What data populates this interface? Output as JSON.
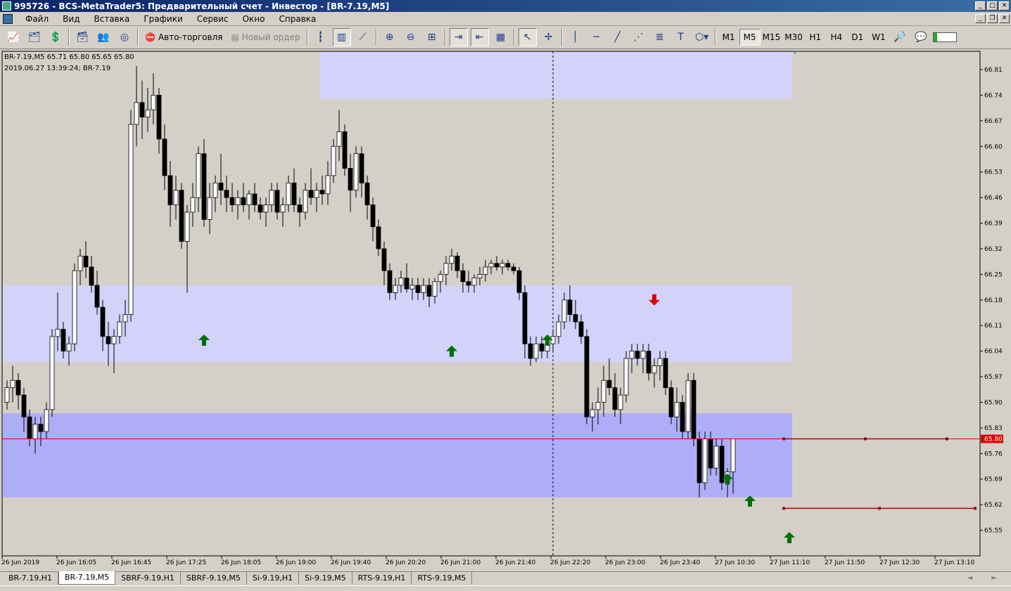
{
  "window": {
    "title": "995726 - BCS-MetaTrader5: Предварительный счет - Инвестор - [BR-7.19,M5]",
    "btn_min": "_",
    "btn_max": "□",
    "btn_close": "✕",
    "btn_restore": "❐"
  },
  "menu": {
    "items": [
      "Файл",
      "Вид",
      "Вставка",
      "Графики",
      "Сервис",
      "Окно",
      "Справка"
    ]
  },
  "toolbar": {
    "autotrade": "Авто-торговля",
    "new_order": "Новый ордер",
    "timeframes": [
      "M1",
      "M5",
      "M15",
      "M30",
      "H1",
      "H4",
      "D1",
      "W1"
    ],
    "active_timeframe": "M5"
  },
  "chart": {
    "info_symbol": "BR-7.19,M5  65.71 65.80 65.65 65.80",
    "info_time": "2019.06.27 13:39:24; BR-7.19",
    "current_price_label": "65.80",
    "colors": {
      "bg": "#d4d0c8",
      "zone_light": "#d2d2fa",
      "zone_mid": "#aeaef8",
      "price_line": "#e00000",
      "arrow_up": "#007000",
      "arrow_down": "#e00000"
    }
  },
  "chart_data": {
    "type": "candlestick",
    "symbol": "BR-7.19",
    "timeframe": "M5",
    "ylim": [
      65.48,
      66.86
    ],
    "yticks": [
      65.55,
      65.62,
      65.69,
      65.76,
      65.83,
      65.9,
      65.97,
      66.04,
      66.11,
      66.18,
      66.25,
      66.32,
      66.39,
      66.46,
      66.53,
      66.6,
      66.67,
      66.74,
      66.81
    ],
    "xlabels": [
      "26 Jun 2019",
      "26 Jun 16:05",
      "26 Jun 16:45",
      "26 Jun 17:25",
      "26 Jun 18:05",
      "26 Jun 19:00",
      "26 Jun 19:40",
      "26 Jun 20:20",
      "26 Jun 21:00",
      "26 Jun 21:40",
      "26 Jun 22:20",
      "26 Jun 23:00",
      "26 Jun 23:40",
      "27 Jun 10:30",
      "27 Jun 11:10",
      "27 Jun 11:50",
      "27 Jun 12:30",
      "27 Jun 13:10"
    ],
    "current_price": 65.8,
    "ohlc": [
      [
        65.9,
        65.96,
        65.88,
        65.94
      ],
      [
        65.94,
        66,
        65.9,
        65.96
      ],
      [
        65.96,
        65.98,
        65.88,
        65.92
      ],
      [
        65.92,
        65.94,
        65.82,
        65.86
      ],
      [
        65.86,
        65.88,
        65.78,
        65.8
      ],
      [
        65.8,
        65.86,
        65.76,
        65.84
      ],
      [
        65.84,
        65.86,
        65.78,
        65.82
      ],
      [
        65.82,
        65.9,
        65.8,
        65.88
      ],
      [
        65.88,
        66.1,
        65.86,
        66.08
      ],
      [
        66.08,
        66.2,
        66.04,
        66.1
      ],
      [
        66.1,
        66.12,
        66.02,
        66.04
      ],
      [
        66.04,
        66.08,
        66,
        66.06
      ],
      [
        66.06,
        66.28,
        66.04,
        66.26
      ],
      [
        66.26,
        66.32,
        66.22,
        66.3
      ],
      [
        66.3,
        66.34,
        66.24,
        66.27
      ],
      [
        66.27,
        66.3,
        66.2,
        66.22
      ],
      [
        66.22,
        66.26,
        66.14,
        66.16
      ],
      [
        66.16,
        66.18,
        66.04,
        66.08
      ],
      [
        66.08,
        66.12,
        66,
        66.06
      ],
      [
        66.06,
        66.1,
        65.98,
        66.08
      ],
      [
        66.08,
        66.14,
        66.06,
        66.12
      ],
      [
        66.12,
        66.18,
        66.08,
        66.14
      ],
      [
        66.14,
        66.7,
        66.12,
        66.66
      ],
      [
        66.66,
        66.82,
        66.6,
        66.72
      ],
      [
        66.72,
        66.78,
        66.62,
        66.68
      ],
      [
        66.68,
        66.76,
        66.64,
        66.7
      ],
      [
        66.7,
        66.8,
        66.66,
        66.74
      ],
      [
        66.74,
        66.76,
        66.58,
        66.62
      ],
      [
        66.62,
        66.66,
        66.48,
        66.52
      ],
      [
        66.52,
        66.56,
        66.38,
        66.44
      ],
      [
        66.44,
        66.52,
        66.4,
        66.48
      ],
      [
        66.48,
        66.5,
        66.32,
        66.34
      ],
      [
        66.34,
        66.44,
        66.2,
        66.42
      ],
      [
        66.42,
        66.5,
        66.38,
        66.46
      ],
      [
        66.46,
        66.6,
        66.42,
        66.58
      ],
      [
        66.58,
        66.62,
        66.38,
        66.4
      ],
      [
        66.4,
        66.5,
        66.36,
        66.46
      ],
      [
        66.46,
        66.52,
        66.42,
        66.5
      ],
      [
        66.5,
        66.58,
        66.44,
        66.48
      ],
      [
        66.48,
        66.52,
        66.42,
        66.46
      ],
      [
        66.46,
        66.5,
        66.42,
        66.44
      ],
      [
        66.44,
        66.48,
        66.4,
        66.46
      ],
      [
        66.46,
        66.5,
        66.42,
        66.44
      ],
      [
        66.44,
        66.48,
        66.4,
        66.47
      ],
      [
        66.47,
        66.5,
        66.42,
        66.44
      ],
      [
        66.44,
        66.46,
        66.4,
        66.42
      ],
      [
        66.42,
        66.46,
        66.38,
        66.44
      ],
      [
        66.44,
        66.5,
        66.42,
        66.48
      ],
      [
        66.48,
        66.5,
        66.4,
        66.42
      ],
      [
        66.42,
        66.46,
        66.38,
        66.44
      ],
      [
        66.44,
        66.52,
        66.42,
        66.5
      ],
      [
        66.5,
        66.54,
        66.42,
        66.44
      ],
      [
        66.44,
        66.46,
        66.38,
        66.42
      ],
      [
        66.42,
        66.5,
        66.4,
        66.48
      ],
      [
        66.48,
        66.54,
        66.44,
        66.46
      ],
      [
        66.46,
        66.5,
        66.42,
        66.48
      ],
      [
        66.48,
        66.52,
        66.44,
        66.47
      ],
      [
        66.47,
        66.56,
        66.44,
        66.52
      ],
      [
        66.52,
        66.62,
        66.5,
        66.6
      ],
      [
        66.6,
        66.7,
        66.56,
        66.64
      ],
      [
        66.64,
        66.66,
        66.52,
        66.54
      ],
      [
        66.54,
        66.58,
        66.42,
        66.48
      ],
      [
        66.48,
        66.6,
        66.46,
        66.58
      ],
      [
        66.58,
        66.6,
        66.46,
        66.5
      ],
      [
        66.5,
        66.52,
        66.4,
        66.44
      ],
      [
        66.44,
        66.46,
        66.34,
        66.38
      ],
      [
        66.38,
        66.4,
        66.3,
        66.32
      ],
      [
        66.32,
        66.34,
        66.22,
        66.26
      ],
      [
        66.26,
        66.28,
        66.18,
        66.2
      ],
      [
        66.2,
        66.24,
        66.18,
        66.22
      ],
      [
        66.22,
        66.26,
        66.2,
        66.24
      ],
      [
        66.24,
        66.28,
        66.2,
        66.21
      ],
      [
        66.21,
        66.24,
        66.18,
        66.22
      ],
      [
        66.22,
        66.24,
        66.18,
        66.2
      ],
      [
        66.2,
        66.24,
        66.18,
        66.22
      ],
      [
        66.22,
        66.24,
        66.16,
        66.19
      ],
      [
        66.19,
        66.24,
        66.17,
        66.23
      ],
      [
        66.23,
        66.26,
        66.2,
        66.25
      ],
      [
        66.25,
        66.3,
        66.22,
        66.28
      ],
      [
        66.28,
        66.32,
        66.26,
        66.3
      ],
      [
        66.3,
        66.31,
        66.24,
        66.26
      ],
      [
        66.26,
        66.28,
        66.2,
        66.23
      ],
      [
        66.23,
        66.26,
        66.2,
        66.22
      ],
      [
        66.22,
        66.25,
        66.2,
        66.24
      ],
      [
        66.24,
        66.27,
        66.22,
        66.25
      ],
      [
        66.25,
        66.29,
        66.23,
        66.27
      ],
      [
        66.27,
        66.29,
        66.25,
        66.28
      ],
      [
        66.28,
        66.3,
        66.26,
        66.27
      ],
      [
        66.27,
        66.29,
        66.25,
        66.28
      ],
      [
        66.28,
        66.29,
        66.26,
        66.27
      ],
      [
        66.27,
        66.28,
        66.25,
        66.26
      ],
      [
        66.26,
        66.27,
        66.18,
        66.2
      ],
      [
        66.2,
        66.22,
        66.02,
        66.06
      ],
      [
        66.06,
        66.08,
        66,
        66.02
      ],
      [
        66.02,
        66.08,
        66.01,
        66.06
      ],
      [
        66.06,
        66.08,
        66.02,
        66.04
      ],
      [
        66.04,
        66.08,
        66.02,
        66.06
      ],
      [
        66.06,
        66.1,
        66.04,
        66.08
      ],
      [
        66.08,
        66.14,
        66.06,
        66.12
      ],
      [
        66.12,
        66.2,
        66.1,
        66.18
      ],
      [
        66.18,
        66.22,
        66.12,
        66.14
      ],
      [
        66.14,
        66.18,
        66.1,
        66.12
      ],
      [
        66.12,
        66.14,
        66.06,
        66.08
      ],
      [
        66.08,
        66.1,
        65.84,
        65.86
      ],
      [
        65.86,
        65.9,
        65.82,
        65.88
      ],
      [
        65.88,
        65.94,
        65.84,
        65.9
      ],
      [
        65.9,
        66,
        65.86,
        65.96
      ],
      [
        65.96,
        66.02,
        65.92,
        65.94
      ],
      [
        65.94,
        65.98,
        65.86,
        65.88
      ],
      [
        65.88,
        65.94,
        65.84,
        65.92
      ],
      [
        65.92,
        66.04,
        65.9,
        66.02
      ],
      [
        66.02,
        66.06,
        65.98,
        66.04
      ],
      [
        66.04,
        66.06,
        66,
        66.02
      ],
      [
        66.02,
        66.06,
        65.98,
        66.04
      ],
      [
        66.04,
        66.06,
        65.96,
        65.98
      ],
      [
        65.98,
        66.02,
        65.94,
        66
      ],
      [
        66,
        66.04,
        65.96,
        66.02
      ],
      [
        66.02,
        66.04,
        65.92,
        65.94
      ],
      [
        65.94,
        65.96,
        65.84,
        65.86
      ],
      [
        65.86,
        65.94,
        65.82,
        65.9
      ],
      [
        65.9,
        65.92,
        65.8,
        65.82
      ],
      [
        65.82,
        65.98,
        65.8,
        65.96
      ],
      [
        65.96,
        65.98,
        65.78,
        65.8
      ],
      [
        65.8,
        65.82,
        65.64,
        65.68
      ],
      [
        65.68,
        65.82,
        65.66,
        65.8
      ],
      [
        65.8,
        65.82,
        65.7,
        65.72
      ],
      [
        65.72,
        65.8,
        65.7,
        65.78
      ],
      [
        65.78,
        65.8,
        65.66,
        65.68
      ],
      [
        65.68,
        65.72,
        65.64,
        65.71
      ],
      [
        65.71,
        65.8,
        65.65,
        65.8
      ]
    ],
    "zones": [
      {
        "y_top": 66.86,
        "y_bottom": 66.73,
        "x_start_index": 56,
        "x_end_index": 139,
        "shade": "light"
      },
      {
        "y_top": 66.22,
        "y_bottom": 66.01,
        "x_start_index": 0,
        "x_end_index": 139,
        "shade": "light"
      },
      {
        "y_top": 65.87,
        "y_bottom": 65.64,
        "x_start_index": 0,
        "x_end_index": 139,
        "shade": "mid"
      }
    ],
    "vline_index": 97,
    "arrows": [
      {
        "dir": "up",
        "index": 35,
        "price": 66.07
      },
      {
        "dir": "up",
        "index": 79,
        "price": 66.04
      },
      {
        "dir": "up",
        "index": 96,
        "price": 66.07
      },
      {
        "dir": "down",
        "index": 115,
        "price": 66.18
      },
      {
        "dir": "up",
        "index": 128,
        "price": 65.69
      },
      {
        "dir": "up",
        "index": 132,
        "price": 65.63
      },
      {
        "dir": "up",
        "index": 139,
        "price": 65.53
      }
    ],
    "levels": [
      {
        "price": 65.8,
        "from_index": 139,
        "to_index": 167
      },
      {
        "price": 65.61,
        "from_index": 139,
        "to_index": 172
      }
    ]
  },
  "tabs": {
    "items": [
      "BR-7.19,H1",
      "BR-7.19,M5",
      "SBRF-9.19,H1",
      "SBRF-9.19,M5",
      "Si-9.19,H1",
      "Si-9.19,M5",
      "RTS-9.19,H1",
      "RTS-9.19,M5"
    ],
    "active": "BR-7.19,M5",
    "scroll": "◄ ►"
  }
}
